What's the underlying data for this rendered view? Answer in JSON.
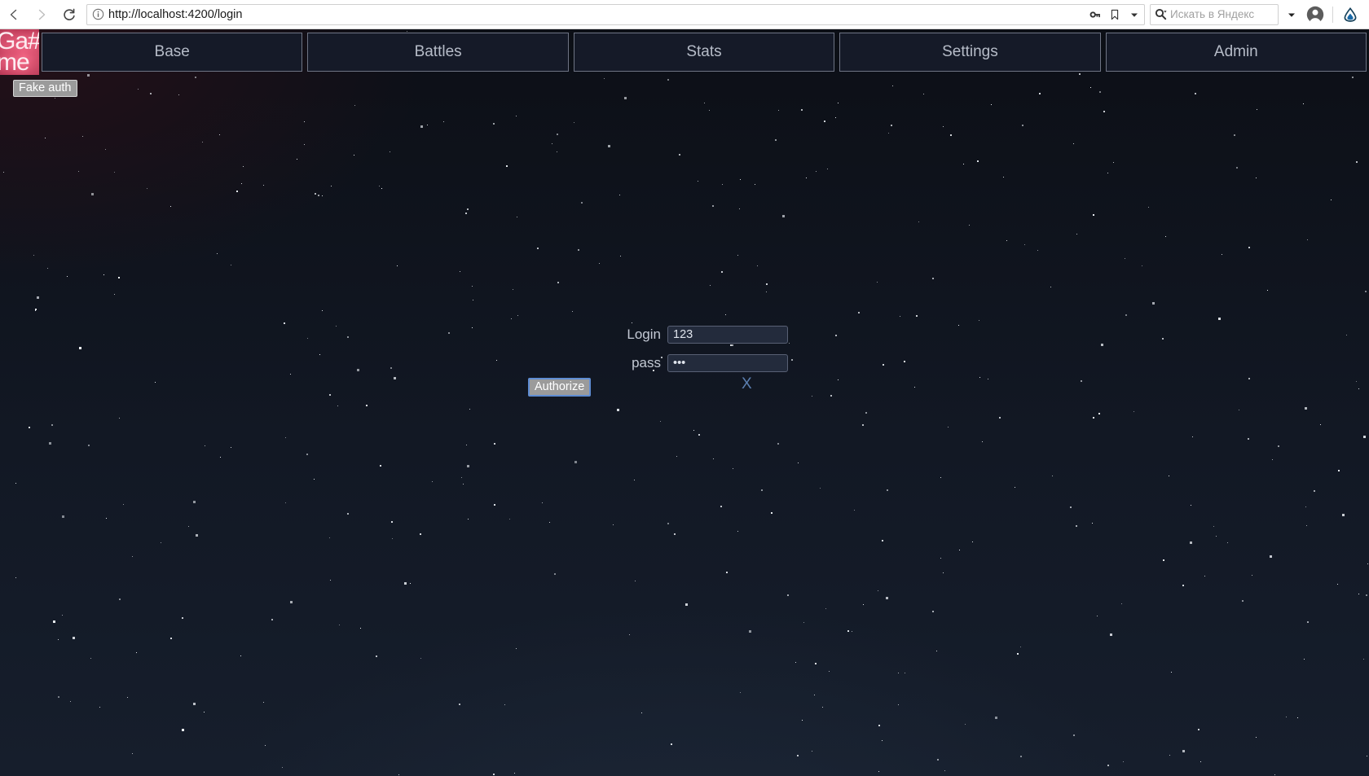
{
  "browser": {
    "back_icon": "back-arrow-icon",
    "forward_icon": "forward-arrow-icon",
    "reload_icon": "reload-icon",
    "info_icon": "page-info-icon",
    "url": "http://localhost:4200/login",
    "key_icon": "key-icon",
    "bookmark_icon": "bookmark-icon",
    "dropdown_icon": "chevron-down-icon",
    "search_icon": "search-icon",
    "search_placeholder": "Искать в Яндекс",
    "search_value": "",
    "search_dropdown_icon": "chevron-down-icon",
    "profile_icon": "user-avatar-icon",
    "browser_logo_icon": "yandex-browser-icon"
  },
  "app": {
    "logo_text": "Ga#\nme",
    "nav_tabs": [
      {
        "label": "Base"
      },
      {
        "label": "Battles"
      },
      {
        "label": "Stats"
      },
      {
        "label": "Settings"
      },
      {
        "label": "Admin"
      }
    ],
    "fake_auth_label": "Fake auth",
    "login_form": {
      "login_label": "Login",
      "login_value": "123",
      "login_placeholder": "",
      "pass_label": "pass",
      "pass_value": "123",
      "pass_placeholder": "",
      "authorize_label": "Authorize",
      "close_label": "X"
    }
  },
  "colors": {
    "accent_pink": "#f06a86",
    "focus_blue": "#5f8dd3",
    "close_blue": "#5b7fb0",
    "nav_border": "#6e7484",
    "nav_bg": "#151a28",
    "input_bg": "#232b3c",
    "page_bg": "#121824"
  }
}
